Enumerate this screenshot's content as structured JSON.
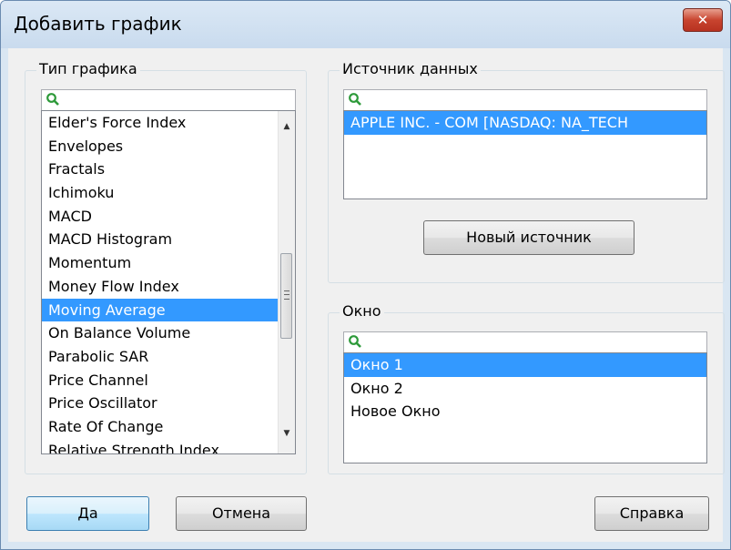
{
  "window": {
    "title": "Добавить график",
    "close_label": "✕"
  },
  "chart_type": {
    "group_label": "Тип графика",
    "search_value": "",
    "items": [
      {
        "label": "Elder's Force Index",
        "selected": false
      },
      {
        "label": "Envelopes",
        "selected": false
      },
      {
        "label": "Fractals",
        "selected": false
      },
      {
        "label": "Ichimoku",
        "selected": false
      },
      {
        "label": "MACD",
        "selected": false
      },
      {
        "label": "MACD Histogram",
        "selected": false
      },
      {
        "label": "Momentum",
        "selected": false
      },
      {
        "label": "Money Flow Index",
        "selected": false
      },
      {
        "label": "Moving Average",
        "selected": true
      },
      {
        "label": "On Balance Volume",
        "selected": false
      },
      {
        "label": "Parabolic SAR",
        "selected": false
      },
      {
        "label": "Price Channel",
        "selected": false
      },
      {
        "label": "Price Oscillator",
        "selected": false
      },
      {
        "label": "Rate Of Change",
        "selected": false
      },
      {
        "label": "Relative Strength Index",
        "selected": false
      }
    ]
  },
  "data_source": {
    "group_label": "Источник данных",
    "search_value": "",
    "items": [
      {
        "label": "APPLE INC. - COM [NASDAQ: NA_TECH",
        "selected": true
      }
    ],
    "new_source_label": "Новый источник"
  },
  "window_group": {
    "group_label": "Окно",
    "search_value": "",
    "items": [
      {
        "label": "Окно 1",
        "selected": true
      },
      {
        "label": "Окно 2",
        "selected": false
      },
      {
        "label": "Новое Окно",
        "selected": false
      }
    ]
  },
  "buttons": {
    "ok": "Да",
    "cancel": "Отмена",
    "help": "Справка"
  },
  "colors": {
    "selection": "#3399ff",
    "search_icon": "#2e9a3a"
  }
}
